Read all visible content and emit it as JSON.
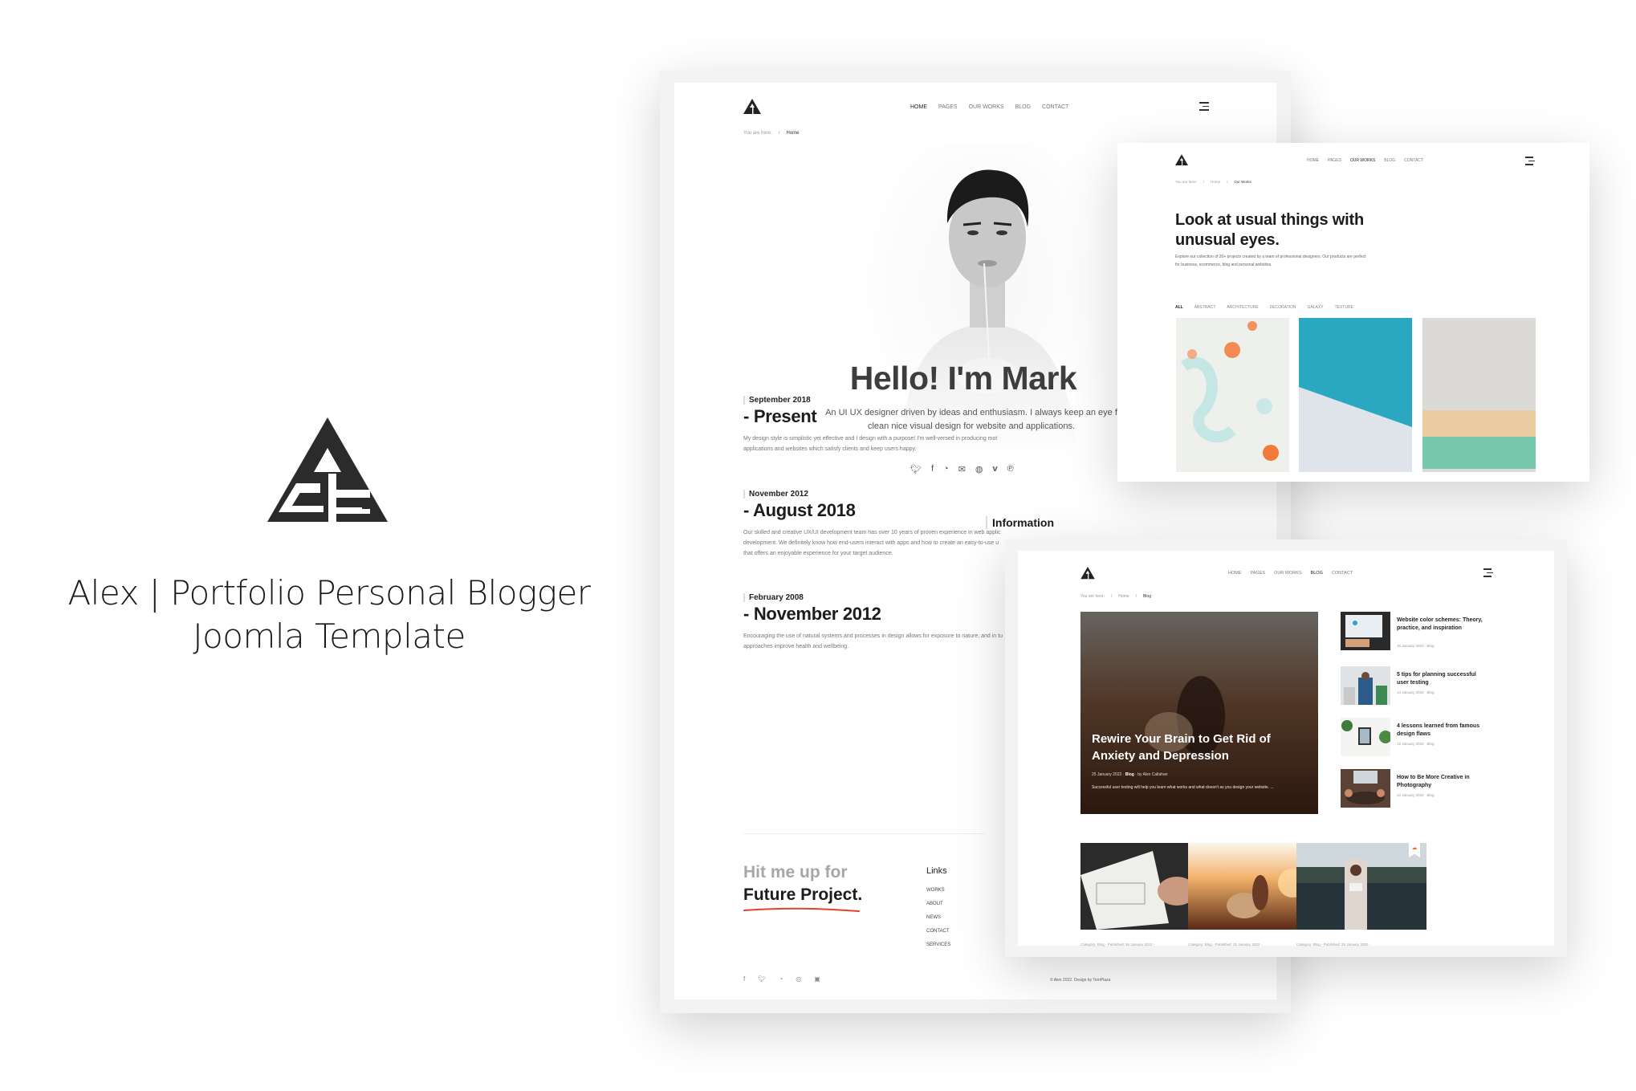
{
  "branding": {
    "logo": "alex-triangle-logo",
    "title_line1": "Alex | Portfolio Personal Blogger",
    "title_line2": "Joomla Template"
  },
  "nav": {
    "items": [
      "HOME",
      "PAGES",
      "OUR WORKS",
      "BLOG",
      "CONTACT"
    ]
  },
  "home_page": {
    "active_nav": "HOME",
    "breadcrumb": {
      "prefix": "You are here:",
      "separator": "/",
      "current": "Home"
    },
    "hero": {
      "title": "Hello! I'm Mark",
      "text_line1": "An UI UX designer driven by ideas and enthusiasm. I always keep an eye f",
      "text_line2": "clean nice visual design for website and applications.",
      "social_icons": [
        "twitter-icon",
        "facebook-icon",
        "github-icon",
        "mail-icon",
        "dribbble-icon",
        "vimeo-icon",
        "pinterest-icon"
      ]
    },
    "timeline": [
      {
        "from": "September 2018",
        "to": "- Present",
        "desc_line1": "My design style is simplistic yet effective and I design with a purpose! I'm well-versed in producing mot",
        "desc_line2": "applications and websites which satisfy clients and keep users happy.",
        "desc_line3": ""
      },
      {
        "from": "November 2012",
        "to": "- August 2018",
        "desc_line1": "Our skilled and creative UX/UI development team has over 10 years of proven experience in web applic",
        "desc_line2": "development. We definitely know how end-users interact with apps and how to create an easy-to-use u",
        "desc_line3": "that offers an enjoyable experience for your target audience."
      },
      {
        "from": "February 2008",
        "to": "- November 2012",
        "desc_line1": "Encouraging the use of natural systems and processes in design allows for exposure to nature, and in tu",
        "desc_line2": "approaches improve health and wellbeing.",
        "desc_line3": ""
      }
    ],
    "information_heading": "Information",
    "cta": {
      "line1": "Hit me up for",
      "line2": "Future Project."
    },
    "links": {
      "heading": "Links",
      "items": [
        "WORKS",
        "ABOUT",
        "NEWS",
        "CONTACT",
        "SERVICES"
      ]
    },
    "footer_social": [
      "facebook-icon",
      "twitter-icon",
      "github-icon",
      "instagram-icon",
      "youtube-icon"
    ],
    "copyright": "© Alex 2022. Design by TemPlaza"
  },
  "works_page": {
    "active_nav": "OUR WORKS",
    "breadcrumb": {
      "prefix": "You are here:",
      "separator": "/",
      "home": "Home",
      "current": "Our Works"
    },
    "title": "Look at usual things with unusual eyes.",
    "description": "Explore our collection of 20+ projects created by a team of professional designers. Our products are perfect for business, ecommerce, blog and personal websites.",
    "filters": [
      "ALL",
      "ABSTRACT",
      "ARCHITECTURE",
      "DECORATION",
      "GALAXY",
      "TEXTURE"
    ],
    "active_filter": "ALL"
  },
  "blog_page": {
    "active_nav": "BLOG",
    "breadcrumb": {
      "prefix": "You are here:",
      "separator": "/",
      "home": "Home",
      "current": "Blog"
    },
    "featured": {
      "title": "Rewire Your Brain to Get Rid of Anxiety and Depression",
      "date": "25 January 2022",
      "category": "Blog",
      "author": "by Alex Callahan",
      "excerpt": "Successful user testing will help you learn what works and what doesn't as you design your website. ..."
    },
    "side_posts": [
      {
        "title": "Website color schemes: Theory, practice, and inspiration",
        "date": "16 January 2022",
        "category": "Blog"
      },
      {
        "title": "5 tips for planning successful user testing",
        "date": "14 January 2022",
        "category": "Blog"
      },
      {
        "title": "4 lessons learned from famous design flaws",
        "date": "12 January 2022",
        "category": "Blog"
      },
      {
        "title": "How to Be More Creative in Photography",
        "date": "10 January 2022",
        "category": "Blog"
      }
    ],
    "bottom_posts": [
      {
        "meta": "Category: Blog - Published: 26 January 2022 -",
        "badge": "star-icon",
        "badge_color": "#f5d76e"
      },
      {
        "meta": "Category: Blog - Published: 25 January 2022 -",
        "badge": "quote-icon",
        "badge_color": "#8fc9f0"
      },
      {
        "meta": "Category: Blog - Published: 25 January 2022 -",
        "badge": "soundcloud-icon",
        "badge_color": "#ffffff"
      }
    ]
  },
  "colors": {
    "accent_underline": "#e0452b",
    "text_dark": "#1c1c1c",
    "text_muted": "#a6a6a6"
  }
}
